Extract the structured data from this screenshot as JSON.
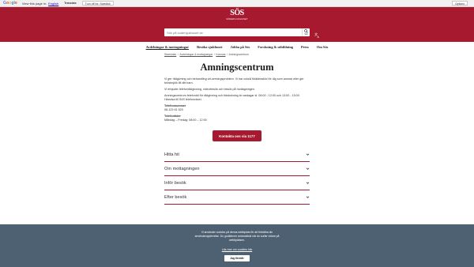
{
  "translate_bar": {
    "logo_letters": [
      "G",
      "o",
      "o",
      "g",
      "l",
      "e"
    ],
    "text": "View this page in:",
    "language": "English",
    "translate_label": "Translate",
    "turn_off_label": "Turn off for: Swedish",
    "options_label": "Options"
  },
  "header": {
    "logo_mark": "SÖS",
    "logo_sub": "SÖDERSJUKHUSET",
    "search_placeholder": "Sök på sodersjukhuset.se",
    "search_button_label": "Sök",
    "translate_label": "Translate",
    "brand_color": "#a6192e"
  },
  "nav": {
    "items": [
      "Avdelningar & mottagningar",
      "Besöka sjukhuset",
      "Jobba på Sös",
      "Forskning & utbildning",
      "Press",
      "Om Sös"
    ]
  },
  "breadcrumb": {
    "items": [
      "Startsidan",
      "Avdelningar & mottagningar",
      "Kvinnas",
      "Amningscentrum"
    ]
  },
  "main": {
    "title": "Amningscentrum",
    "paragraph1": "Vi ger rådgivning och behandling vid amningsproblem. Vi har också föräldrastöd för dig som ammar eller ger bröstmjölk till ditt barn.",
    "paragraph2": "Vi erbjuder telefonrådgivning, videobesök och besök på mottagningen.",
    "paragraph3": "Amningscentrum telefontid för rådgivning och tidsbokning är vardagar kl. 08:00 - 12:00 och 13:00 - 15:00. Hänvisa till SöS telefonväxel.",
    "phone_label": "Telefonnummer",
    "phone_value": "08-123 61 520",
    "hours_label": "Telefontider",
    "hours_value": "Måndag – Fredag: 08:00 – 12:00",
    "cta_label": "Kontakta oss via 1177"
  },
  "accordion": {
    "items": [
      "Hitta hit",
      "Om mottagningen",
      "Inför besök",
      "Efter besök"
    ]
  },
  "cookie": {
    "text": "Vi använder cookies på denna webbplats för att förbättra din användarupplevelse. Du godkänner automatiskt när du surfar vidare på webbplatsen.",
    "link": "Läs mer om cookies här",
    "button": "Jag förstår"
  }
}
